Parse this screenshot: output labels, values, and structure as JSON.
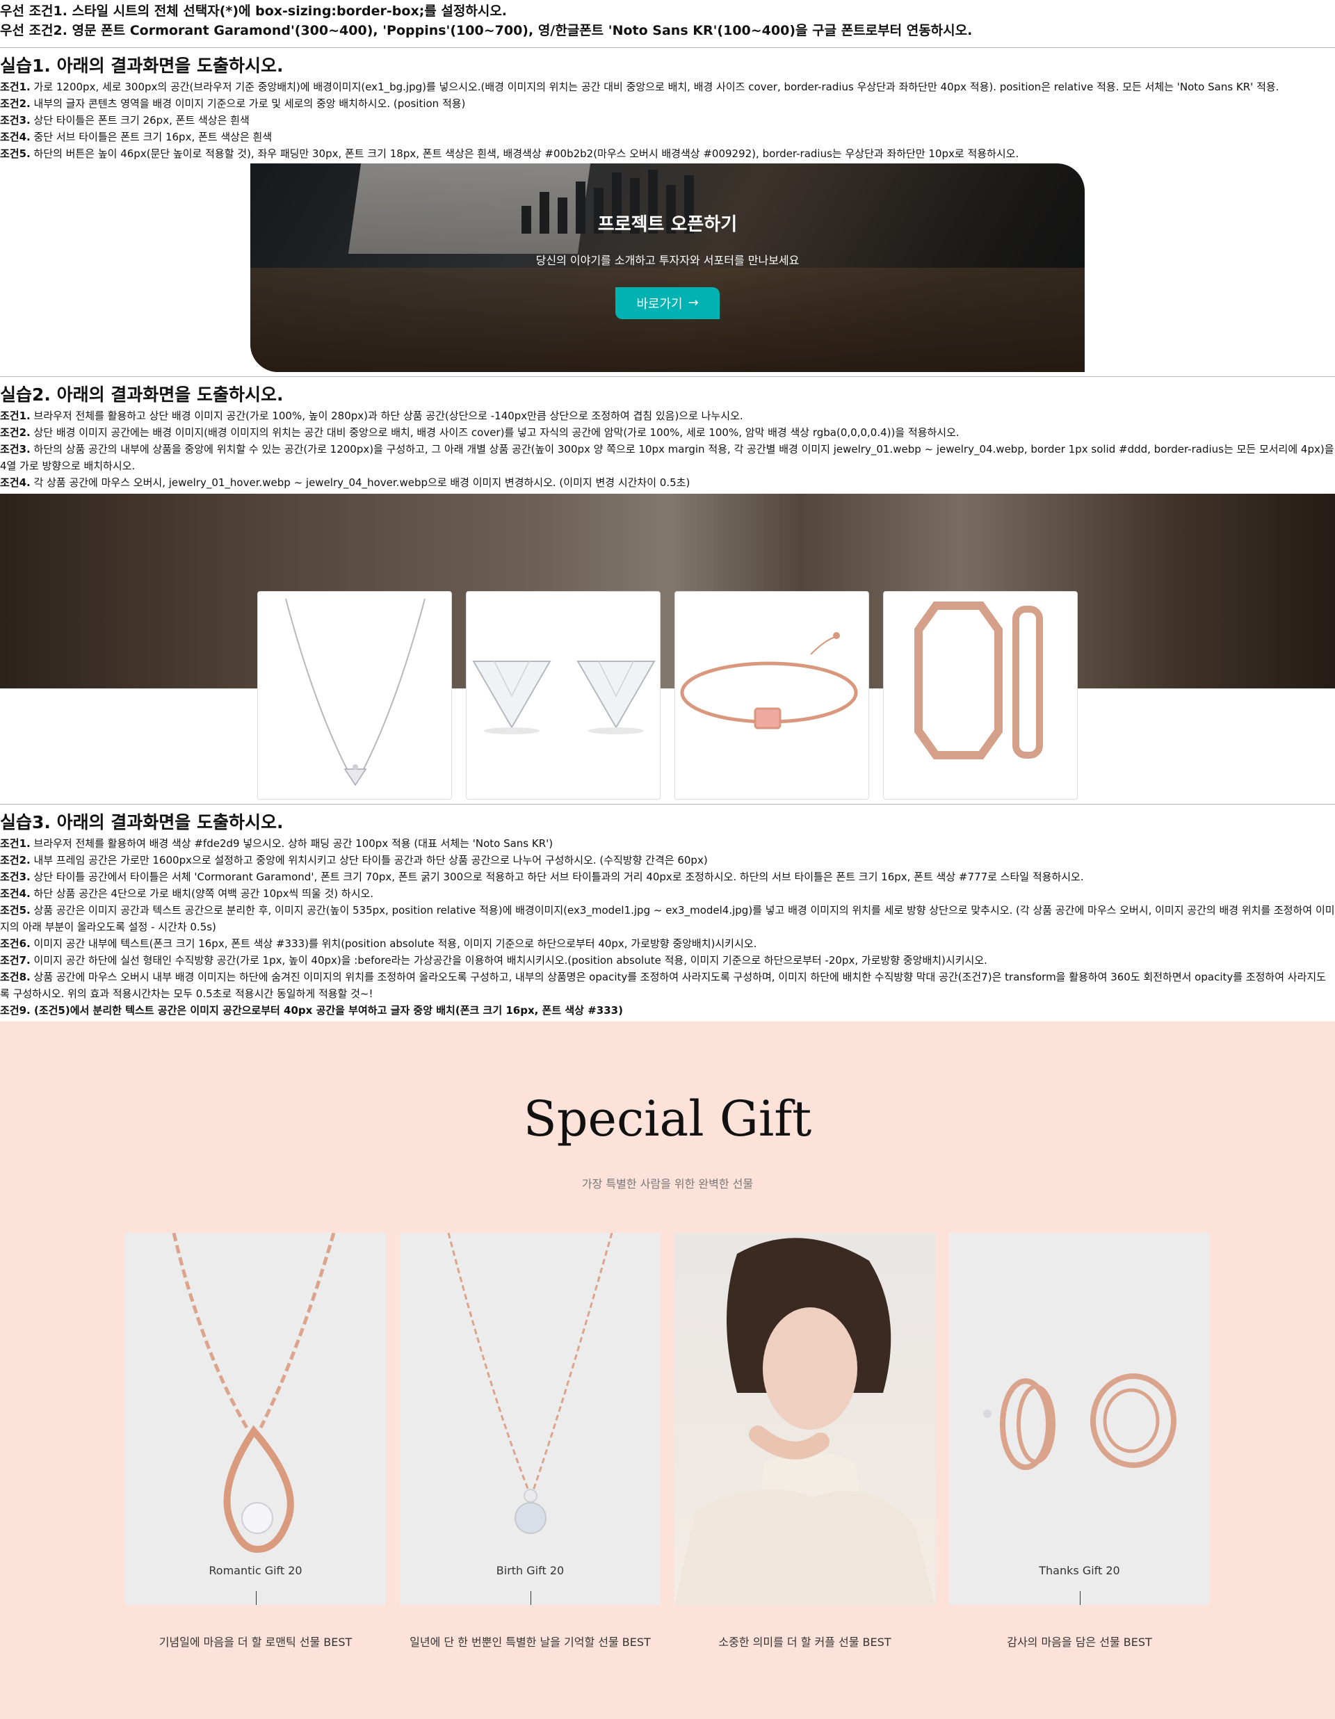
{
  "pre_conditions": [
    "우선 조건1. 스타일 시트의 전체 선택자(*)에 box-sizing:border-box;를 설정하시오.",
    "우선 조건2. 영문 폰트 Cormorant Garamond'(300~400), 'Poppins'(100~700), 영/한글폰트 'Noto Sans KR'(100~400)을 구글 폰트로부터 연동하시오."
  ],
  "ex1": {
    "title": "실습1. 아래의 결과화면을 도출하시오.",
    "conds": [
      {
        "label": "조건1.",
        "text": " 가로 1200px, 세로 300px의 공간(브라우저 기준 중앙배치)에 배경이미지(ex1_bg.jpg)를 넣으시오.(배경 이미지의 위치는 공간 대비 중앙으로 배치, 배경 사이즈 cover, border-radius 우상단과 좌하단만 40px 적용). position은 relative 적용. 모든 서체는 'Noto Sans KR' 적용."
      },
      {
        "label": "조건2.",
        "text": " 내부의 글자 콘텐츠 영역을 배경 이미지 기준으로 가로 및 세로의 중앙 배치하시오. (position 적용)"
      },
      {
        "label": "조건3.",
        "text": " 상단 타이틀은 폰트 크기 26px, 폰트 색상은 흰색"
      },
      {
        "label": "조건4.",
        "text": " 중단 서브 타이틀은 폰트 크기 16px, 폰트 색상은 흰색"
      },
      {
        "label": "조건5.",
        "text": " 하단의 버튼은 높이 46px(문단 높이로 적용할 것), 좌우 패딩만 30px, 폰트 크기 18px, 폰트 색상은 흰색, 배경색상 #00b2b2(마우스 오버시 배경색상 #009292), border-radius는 우상단과 좌하단만 10px로 적용하시오."
      }
    ],
    "heading": "프로젝트 오픈하기",
    "subtitle": "당신의 이야기를 소개하고 투자자와 서포터를 만나보세요",
    "button": "바로가기",
    "button_arrow": "→"
  },
  "ex2": {
    "title": "실습2. 아래의 결과화면을 도출하시오.",
    "conds": [
      {
        "label": "조건1.",
        "text": " 브라우저 전체를 활용하고 상단 배경 이미지 공간(가로 100%, 높이 280px)과 하단 상품 공간(상단으로 -140px만큼 상단으로 조정하여 겹침 있음)으로 나누시오."
      },
      {
        "label": "조건2.",
        "text": " 상단 배경 이미지 공간에는 배경 이미지(배경 이미지의 위치는 공간 대비 중앙으로 배치, 배경 사이즈 cover)를 넣고 자식의 공간에 암막(가로 100%, 세로 100%, 암막 배경 색상 rgba(0,0,0,0.4))을 적용하시오."
      },
      {
        "label": "조건3.",
        "text": " 하단의 상품 공간의 내부에 상품을 중앙에 위치할 수 있는 공간(가로 1200px)을 구성하고, 그 아래 개별 상품 공간(높이 300px 양 쪽으로 10px margin 적용, 각 공간별 배경 이미지 jewelry_01.webp ~ jewelry_04.webp, border 1px solid #ddd, border-radius는 모든 모서리에 4px)을 4열 가로 방향으로 배치하시오."
      },
      {
        "label": "조건4.",
        "text": " 각 상품 공간에 마우스 오버시, jewelry_01_hover.webp ~ jewelry_04_hover.webp으로 배경 이미지 변경하시오. (이미지 변경 시간차이 0.5초)"
      }
    ]
  },
  "ex3": {
    "title": "실습3. 아래의 결과화면을 도출하시오.",
    "conds": [
      {
        "label": "조건1.",
        "text": " 브라우저 전체를 활용하여 배경 색상 #fde2d9 넣으시오. 상하 패딩 공간 100px 적용 (대표 서체는 'Noto Sans KR')"
      },
      {
        "label": "조건2.",
        "text": " 내부 프레임 공간은 가로만 1600px으로 설정하고 중앙에 위치시키고 상단 타이틀 공간과 하단 상품 공간으로 나누어 구성하시오. (수직방향 간격은 60px)"
      },
      {
        "label": "조건3.",
        "text": " 상단 타이틀 공간에서 타이틀은 서체 'Cormorant Garamond', 폰트 크기 70px, 폰트 굵기 300으로 적용하고 하단 서브 타이틀과의 거리 40px로 조정하시오. 하단의 서브 타이틀은 폰트 크기 16px, 폰트 색상 #777로 스타일 적용하시오."
      },
      {
        "label": "조건4.",
        "text": " 하단 상품 공간은 4단으로 가로 배치(양쪽 여백 공간 10px씩 띄울 것) 하시오."
      },
      {
        "label": "조건5.",
        "text": " 상품 공간은 이미지 공간과 텍스트 공간으로 분리한 후, 이미지 공간(높이 535px, position relative 적용)에 배경이미지(ex3_model1.jpg ~ ex3_model4.jpg)를 넣고 배경 이미지의 위치를 세로 방향 상단으로 맞추시오. (각 상품 공간에 마우스 오버시, 이미지 공간의 배경 위치를 조정하여 이미지의 아래 부분이 올라오도록 설정 - 시간차 0.5s)"
      },
      {
        "label": "조건6.",
        "text": " 이미지 공간 내부에 텍스트(폰크 크기 16px, 폰트 색상 #333)를 위치(position absolute 적용, 이미지 기준으로 하단으로부터 40px, 가로방향 중앙배치)시키시오."
      },
      {
        "label": "조건7.",
        "text": " 이미지 공간 하단에 실선 형태인 수직방향 공간(가로 1px, 높이 40px)을 :before라는 가상공간을 이용하여 배치시키시오.(position absolute 적용, 이미지 기준으로 하단으로부터 -20px, 가로방향 중앙배치)시키시오."
      },
      {
        "label": "조건8.",
        "text": " 상품 공간에 마우스 오버시 내부 배경 이미지는 하단에 숨겨진 이미지의 위치를 조정하여 올라오도록 구성하고, 내부의 상품명은 opacity를 조정하여 사라지도록 구성하며, 이미지 하단에 배치한 수직방향 막대 공간(조건7)은 transform을 활용하여 360도 회전하면서 opacity를 조정하여 사라지도록 구성하시오. 위의 효과 적용시간차는 모두 0.5초로 적용시간 동일하게 적용할 것~!"
      },
      {
        "label": "조건9.",
        "text": " (조건5)에서 분리한 텍스트 공간은 이미지 공간으로부터 40px 공간을 부여하고 글자 중앙 배치(폰크 크기 16px, 폰트 색상 #333)"
      }
    ],
    "heading": "Special Gift",
    "subtitle": "가장 특별한 사람을 위한 완벽한 선물",
    "items": [
      {
        "name": "Romantic Gift 20",
        "text": "기념일에 마음을 더 할 로맨틱 선물 BEST"
      },
      {
        "name": "Birth Gift 20",
        "text": "일년에 단 한 번뿐인 특별한 날을 기억할 선물 BEST"
      },
      {
        "name": "",
        "text": "소중한 의미를 더 할 커플 선물 BEST"
      },
      {
        "name": "Thanks Gift 20",
        "text": "감사의 마음을 담은 선물 BEST"
      }
    ]
  }
}
